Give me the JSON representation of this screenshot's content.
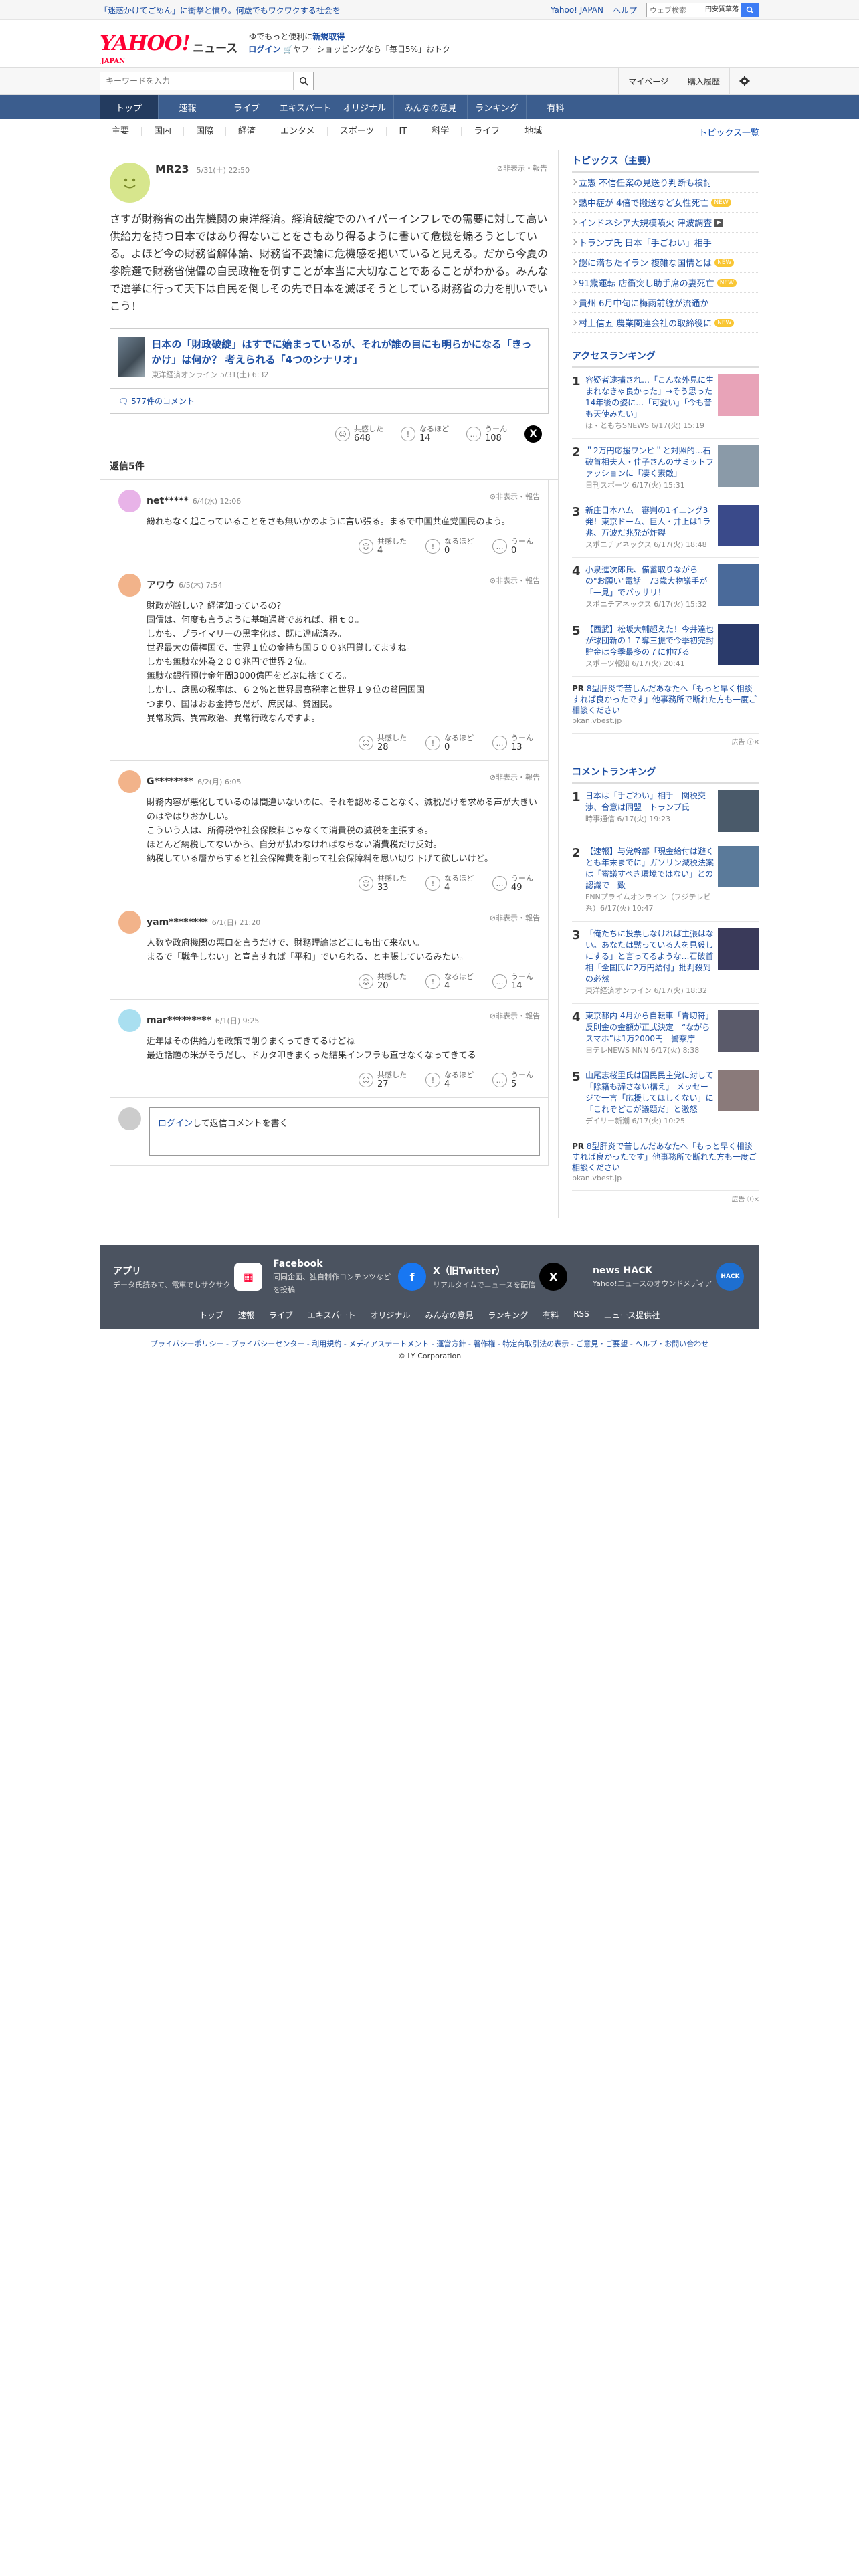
{
  "topbar": {
    "promo": "「迷惑かけてごめん」に衝撃と憤り。何歳でもワクワクする社会を",
    "links": [
      "Yahoo! JAPAN",
      "ヘルプ"
    ],
    "web_search_placeholder": "ウェブ検索",
    "web_search_chip": "円安質草落"
  },
  "header": {
    "logo_main": "YAHOO!",
    "logo_sub": "ニュース",
    "logo_japan": "JAPAN",
    "promo_line1": "ゆでもっと便利に",
    "promo_line1_bold": "新規取得",
    "promo_line2_login": "ログイン",
    "promo_line2": "ヤフーショッピングなら「毎日5%」おトク"
  },
  "search": {
    "placeholder": "キーワードを入力",
    "mypage": "マイページ",
    "history": "購入履歴"
  },
  "gnav": [
    "トップ",
    "速報",
    "ライブ",
    "エキスパート",
    "オリジナル",
    "みんなの意見",
    "ランキング",
    "有料"
  ],
  "snav": {
    "items": [
      "主要",
      "国内",
      "国際",
      "経済",
      "エンタメ",
      "スポーツ",
      "IT",
      "科学",
      "ライフ",
      "地域"
    ],
    "topics": "トピックス一覧"
  },
  "comment": {
    "user": "MR23",
    "time": "5/31(土) 22:50",
    "report": "非表示・報告",
    "text": "さすが財務省の出先機関の東洋経済。経済破綻でのハイパーインフレでの需要に対して高い供給力を持つ日本ではあり得ないことをさもあり得るように書いて危機を煽ろうとしている。よほど今の財務省解体論、財務省不要論に危機感を抱いていると見える。だから今夏の参院選で財務省傀儡の自民政権を倒すことが本当に大切なことであることがわかる。みんなで選挙に行って天下は自民を倒しその先で日本を滅ぼそうとしている財務省の力を削いでいこう！",
    "article_title": "日本の「財政破綻」はすでに始まっているが、それが誰の目にも明らかになる「きっかけ」は何か？ 考えられる「4つのシナリオ」",
    "article_source": "東洋経済オンライン 5/31(土) 6:32",
    "comment_count": "577件のコメント",
    "reactions": {
      "agree_label": "共感した",
      "agree": "648",
      "think_label": "なるほど",
      "think": "14",
      "hmm_label": "うーん",
      "hmm": "108"
    }
  },
  "replies_header": "返信5件",
  "replies": [
    {
      "user": "net*****",
      "time": "6/4(水) 12:06",
      "text": "紛れもなく起こっていることをさも無いかのように言い張る。まるで中国共産党国民のよう。",
      "agree": "4",
      "think": "0",
      "hmm": "0",
      "color": "#e8b3e8"
    },
    {
      "user": "アワウ",
      "time": "6/5(木) 7:54",
      "text": "財政が厳しい？経済知っているの？\n国債は、何度も言うように基軸通貨であれば、粗ｔ０。\nしかも、プライマリーの黒字化は、既に達成済み。\n世界最大の債権国で、世界１位の金持ち国５００兆円貸してますね。\nしかも無駄な外為２００兆円で世界２位。\n無駄な銀行預け金年間3000億円をどぶに捨ててる。\nしかし、庶民の税率は、６２％と世界最高税率と世界１９位の貧困国国\nつまり、国はおお金持ちだが、庶民は、貧困民。\n異常政策、異常政治、異常行政なんですよ。",
      "agree": "28",
      "think": "0",
      "hmm": "13",
      "color": "#f2b38a"
    },
    {
      "user": "G********",
      "time": "6/2(月) 6:05",
      "text": "財務内容が悪化しているのは間違いないのに、それを認めることなく、減税だけを求める声が大きいのはやはりおかしい。\nこういう人は、所得税や社会保険料じゃなくて消費税の減税を主張する。\nほとんど納税してないから、自分が払わなければならない消費税だけ反対。\n納税している層からすると社会保障費を削って社会保障料を思い切り下げて欲しいけど。",
      "agree": "33",
      "think": "4",
      "hmm": "49",
      "color": "#f2b38a"
    },
    {
      "user": "yam********",
      "time": "6/1(日) 21:20",
      "text": "人数や政府機関の悪口を言うだけで、財務理論はどこにも出て来ない。\nまるで「戦争しない」と宣言すれば「平和」でいられる、と主張しているみたい。",
      "agree": "20",
      "think": "4",
      "hmm": "14",
      "color": "#f2b38a"
    },
    {
      "user": "mar*********",
      "time": "6/1(日) 9:25",
      "text": "近年はその供給力を政策で削りまくってきてるけどね\n最近話題の米がそうだし、ドカタ叩きまくった結果インフラも直せなくなってきてる",
      "agree": "27",
      "think": "4",
      "hmm": "5",
      "color": "#a9dff0"
    }
  ],
  "reply_form": {
    "login": "ログイン",
    "text": "して返信コメントを書く"
  },
  "topics": {
    "header": "トピックス（主要）",
    "items": [
      {
        "t": "立憲 不信任案の見送り判断も検討",
        "b": ""
      },
      {
        "t": "熱中症が 4倍で搬送など女性死亡",
        "b": "NEW"
      },
      {
        "t": "インドネシア大規模噴火 津波調査",
        "b": "CAM"
      },
      {
        "t": "トランプ氏 日本「手ごわい」相手",
        "b": ""
      },
      {
        "t": "謎に満ちたイラン 複雑な国情とは",
        "b": "NEW"
      },
      {
        "t": "91歳運転 店衝突し助手席の妻死亡",
        "b": "NEW"
      },
      {
        "t": "貴州 6月中旬に梅雨前線が流通か",
        "b": ""
      },
      {
        "t": "村上信五 農業関連会社の取締役に",
        "b": "NEW"
      }
    ]
  },
  "access_ranking": {
    "header": "アクセスランキング",
    "items": [
      {
        "t": "容疑者逮捕され…「こんな外見に生まれなきゃ良かった」→そう思った14年後の姿に…「可愛い」「今も昔も天使みたい」",
        "s": "ほ・ともちSNEWS 6/17(火) 15:19",
        "c": "#e8a3b8"
      },
      {
        "t": "＂2万円応援ワンピ＂と対照的…石破首相夫人・佳子さんのサミットファッションに「凄く素敵」",
        "s": "日刊スポーツ 6/17(火) 15:31",
        "c": "#8a9aa8"
      },
      {
        "t": "新庄日本ハム　審判の1イニング3発！東京ドーム、巨人・井上は1ラ兆、万波だ兆発が炸裂",
        "s": "スポニチアネックス 6/17(火) 18:48",
        "c": "#3a4a8a"
      },
      {
        "t": "小泉進次郎氏、備蓄取りながらの\"お願い\"電話　73歳大物議手が「一見」でバッサリ！",
        "s": "スポニチアネックス 6/17(火) 15:32",
        "c": "#4a6a9a"
      },
      {
        "t": "【西武】松坂大輔超えた！今井達也が球団新の１７奪三振で今季初完封　貯金は今季最多の７に伸びる",
        "s": "スポーツ報知 6/17(火) 20:41",
        "c": "#2a3a6a"
      }
    ]
  },
  "pr1": {
    "label": "PR",
    "text": "8型肝炎で苦しんだあなたへ「もっと早く相談すれば良かったです」他事務所で断れた方も一度ご相談ください",
    "url": "bkan.vbest.jp",
    "ad": "広告"
  },
  "comment_ranking": {
    "header": "コメントランキング",
    "items": [
      {
        "t": "日本は「手ごわい」相手　関税交渉、合意は同盟　トランプ氏",
        "s": "時事通信 6/17(火) 19:23",
        "c": "#4a5a6a"
      },
      {
        "t": "【速報】与党幹部「現金給付は避くとも年末までに」ガソリン減税法案は「審議すべき環境ではない」との認識で一致",
        "s": "FNNプライムオンライン（フジテレビ系）6/17(火) 10:47",
        "c": "#5a7a9a"
      },
      {
        "t": "「俺たちに投票しなければ主張はない。あなたは黙っている人を見殺しにする」と言ってるような…石破首相「全国民に2万円給付」批判殺到の必然",
        "s": "東洋経済オンライン 6/17(火) 18:32",
        "c": "#3a3a5a"
      },
      {
        "t": "東京都内 4月から自転車「青切符」反則金の金額が正式決定　“ながらスマホ”は1万2000円　警察庁",
        "s": "日テレNEWS NNN 6/17(火) 8:38",
        "c": "#5a5a6a"
      },
      {
        "t": "山尾志桜里氏は国民民主党に対して「除籍も辞さない構え」 メッセージで一言「応援してほしくない」に「これぞどこが議題だ」と激怒",
        "s": "デイリー新潮 6/17(火) 10:25",
        "c": "#8a7a7a"
      }
    ]
  },
  "pr2": {
    "label": "PR",
    "text": "8型肝炎で苦しんだあなたへ「もっと早く相談すれば良かったです」他事務所で断れた方も一度ご相談ください",
    "url": "bkan.vbest.jp",
    "ad": "広告"
  },
  "footer": {
    "cols": [
      {
        "title": "アプリ",
        "desc": "データ氏読みて、電車でもサクサク",
        "icon": "app"
      },
      {
        "title": "Facebook",
        "desc": "同同企画、独自制作コンテンツなどを投稿",
        "icon": "f"
      },
      {
        "title": "X（旧Twitter）",
        "desc": "リアルタイムでニュースを配信",
        "icon": "X"
      },
      {
        "title": "news HACK",
        "desc": "Yahoo!ニュースのオウンドメディア",
        "icon": "HACK"
      }
    ],
    "links": [
      "トップ",
      "速報",
      "ライブ",
      "エキスパート",
      "オリジナル",
      "みんなの意見",
      "ランキング",
      "有料",
      "RSS",
      "ニュース提供社"
    ],
    "legal": "プライバシーポリシー - プライバシーセンター - 利用規約 - メディアステートメント - 運営方針 - 著作権 - 特定商取引法の表示 - ご意見・ご要望 - ヘルプ・お問い合わせ",
    "copyright": "© LY Corporation"
  }
}
